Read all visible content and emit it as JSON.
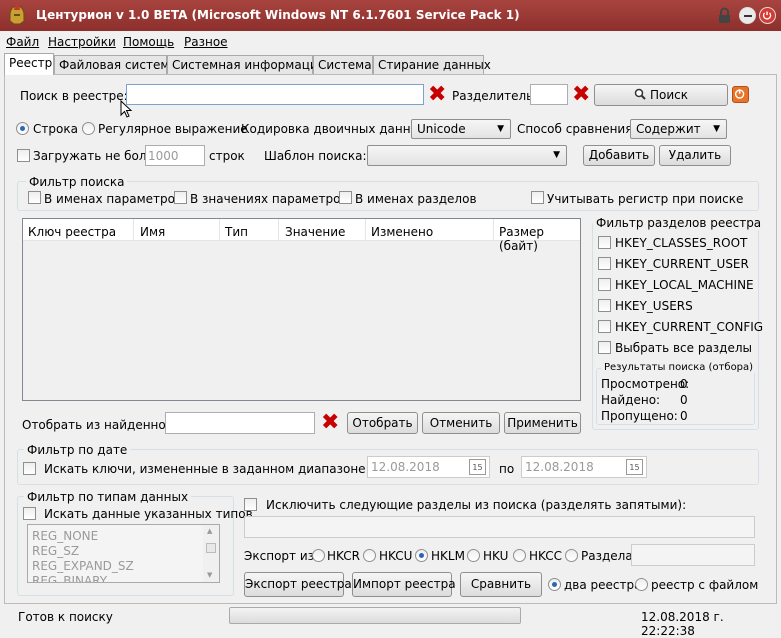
{
  "window": {
    "title": "Центурион v 1.0 BETA (Microsoft Windows NT 6.1.7601 Service Pack 1)"
  },
  "menu": [
    "Файл",
    "Настройки",
    "Помощь",
    "Разное"
  ],
  "tabs": [
    "Реестр",
    "Файловая система",
    "Системная информация",
    "Система",
    "Стирание данных"
  ],
  "search": {
    "label": "Поиск в реестре:",
    "value": "",
    "separator_label": "Разделитель:",
    "separator_value": "",
    "search_button": "Поиск"
  },
  "mode": {
    "string_label": "Строка",
    "regex_label": "Регулярное выражение",
    "encoding_label": "Кодировка двоичных данных:",
    "encoding_value": "Unicode",
    "compare_label": "Способ сравнения:",
    "compare_value": "Содержит"
  },
  "limit": {
    "label": "Загружать не более",
    "value": "1000",
    "unit": "строк",
    "template_label": "Шаблон поиска:",
    "template_value": "",
    "add_button": "Добавить",
    "delete_button": "Удалить"
  },
  "search_filter": {
    "legend": "Фильтр поиска",
    "param_names": "В именах параметров",
    "param_values": "В значениях параметров",
    "section_names": "В именах разделов",
    "case_sensitive": "Учитывать регистр при поиске"
  },
  "results_table": {
    "columns": [
      "Ключ реестра",
      "Имя",
      "Тип",
      "Значение",
      "Изменено",
      "Размер (байт)"
    ]
  },
  "hive_filter": {
    "legend": "Фильтр разделов реестра",
    "items": [
      "HKEY_CLASSES_ROOT",
      "HKEY_CURRENT_USER",
      "HKEY_LOCAL_MACHINE",
      "HKEY_USERS",
      "HKEY_CURRENT_CONFIG",
      "Выбрать все разделы"
    ]
  },
  "results": {
    "legend": "Результаты поиска (отбора)",
    "viewed_label": "Просмотрено:",
    "viewed": "0",
    "found_label": "Найдено:",
    "found": "0",
    "skipped_label": "Пропущено:",
    "skipped": "0"
  },
  "select_found": {
    "label": "Отобрать из найденного:",
    "value": "",
    "select_button": "Отобрать",
    "cancel_button": "Отменить",
    "apply_button": "Применить"
  },
  "date_filter": {
    "legend": "Фильтр по дате",
    "label": "Искать ключи, измененные в заданном диапазоне дат: с",
    "from": "12.08.2018",
    "to_label": "по",
    "to": "12.08.2018",
    "calendar_day": "15"
  },
  "type_filter": {
    "legend": "Фильтр по типам данных",
    "checkbox_label": "Искать данные указанных типов",
    "types": [
      "REG_NONE",
      "REG_SZ",
      "REG_EXPAND_SZ",
      "REG_BINARY"
    ]
  },
  "exclude": {
    "label": "Исключить следующие разделы из поиска (разделять запятыми):",
    "value": ""
  },
  "export": {
    "label": "Экспорт из:",
    "options": [
      "HKCR",
      "HKCU",
      "HKLM",
      "HKU",
      "HKCC",
      "Раздела:"
    ],
    "selected": "HKLM",
    "section_value": "",
    "export_button": "Экспорт реестра",
    "import_button": "Импорт реестра",
    "compare_button": "Сравнить",
    "two_registries": "два реестра",
    "registry_with_file": "реестр с файлом"
  },
  "status": {
    "text": "Готов к поиску",
    "datetime": "12.08.2018 г. 22:22:38"
  },
  "colors": {
    "titlebar": "#9a3a36",
    "close_button": "#d63b33",
    "accent_x": "#c80000",
    "orange_stop": "#e8742b"
  }
}
